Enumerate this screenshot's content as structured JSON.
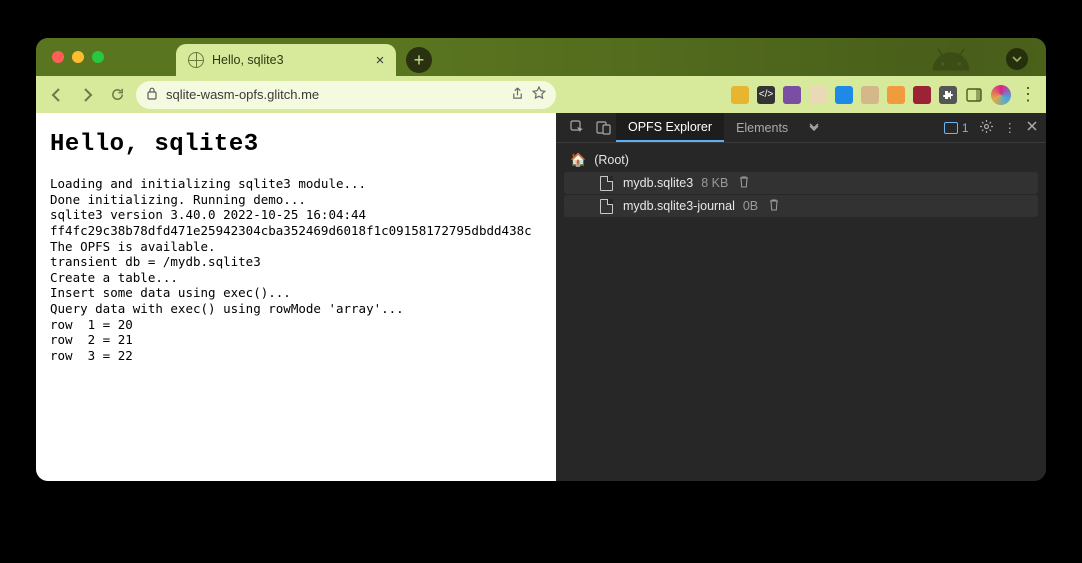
{
  "tab": {
    "title": "Hello, sqlite3"
  },
  "address": {
    "url": "sqlite-wasm-opfs.glitch.me"
  },
  "page": {
    "heading": "Hello, sqlite3",
    "lines": [
      "Loading and initializing sqlite3 module...",
      "Done initializing. Running demo...",
      "sqlite3 version 3.40.0 2022-10-25 16:04:44",
      "ff4fc29c38b78dfd471e25942304cba352469d6018f1c09158172795dbdd438c",
      "The OPFS is available.",
      "transient db = /mydb.sqlite3",
      "Create a table...",
      "Insert some data using exec()...",
      "Query data with exec() using rowMode 'array'...",
      "row  1 = 20",
      "row  2 = 21",
      "row  3 = 22"
    ]
  },
  "devtools": {
    "tabs": {
      "active": "OPFS Explorer",
      "next": "Elements"
    },
    "issues_count": "1",
    "tree": {
      "root_label": "(Root)",
      "files": [
        {
          "name": "mydb.sqlite3",
          "size": "8 KB"
        },
        {
          "name": "mydb.sqlite3-journal",
          "size": "0B"
        }
      ]
    }
  }
}
